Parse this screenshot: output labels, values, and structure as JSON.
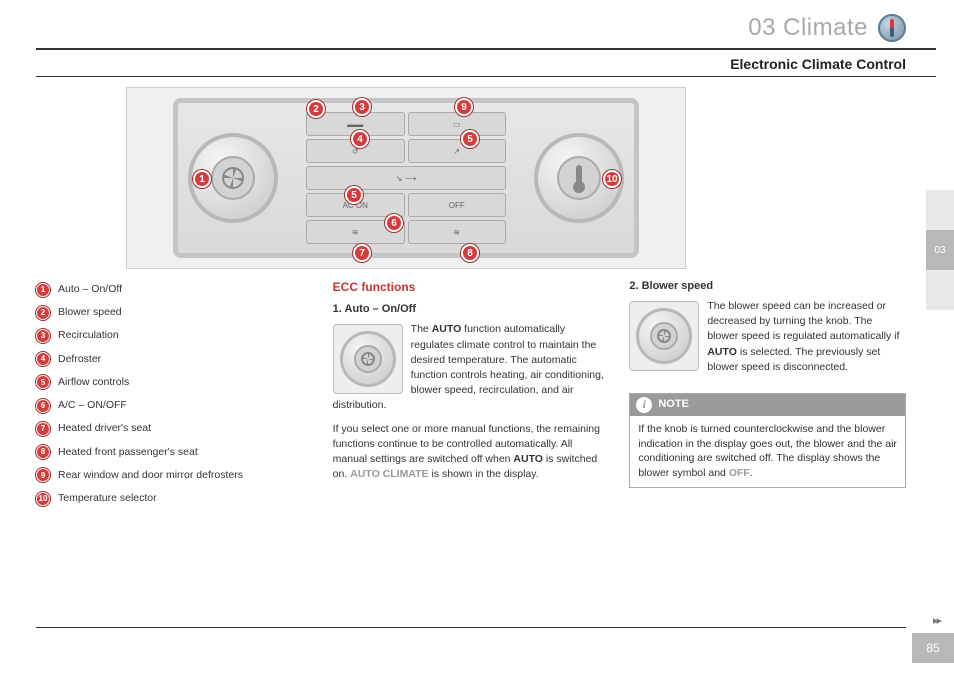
{
  "chapter": {
    "number": "03",
    "title": "Climate"
  },
  "section_title": "Electronic Climate Control",
  "side_tab": "03",
  "page_number": "85",
  "continue_marker": "▸▸",
  "legend": [
    "Auto – On/Off",
    "Blower speed",
    "Recirculation",
    "Defroster",
    "Airflow controls",
    "A/C – ON/OFF",
    "Heated driver's seat",
    "Heated front passenger's seat",
    "Rear window and door mirror defrosters",
    "Temperature selector"
  ],
  "col2": {
    "heading": "ECC functions",
    "sub1": "1. Auto – On/Off",
    "p1_pre": "The ",
    "p1_bold": "AUTO",
    "p1_post": " function automatically regulates climate control to maintain the desired temperature. The automatic function controls heating, air conditioning, blower speed, recirculation, and air distribution.",
    "p2_pre": "If you select one or more manual functions, the remaining functions continue to be controlled automatically. All manual settings are switched off when ",
    "p2_bold": "AUTO",
    "p2_mid": " is switched on. ",
    "p2_grey": "AUTO CLIMATE",
    "p2_post": " is shown in the display."
  },
  "col3": {
    "sub": "2. Blower speed",
    "p_pre": "The blower speed can be increased or decreased by turning the knob. The blower speed is regulated automatically if ",
    "p_bold": "AUTO",
    "p_post": " is selected. The previously set blower speed is disconnected.",
    "note_label": "NOTE",
    "note_body_pre": "If the knob is turned counterclockwise and the blower indication in the display goes out, the blower and the air conditioning are switched off. The display shows the blower symbol and ",
    "note_body_grey": "OFF",
    "note_body_post": "."
  }
}
